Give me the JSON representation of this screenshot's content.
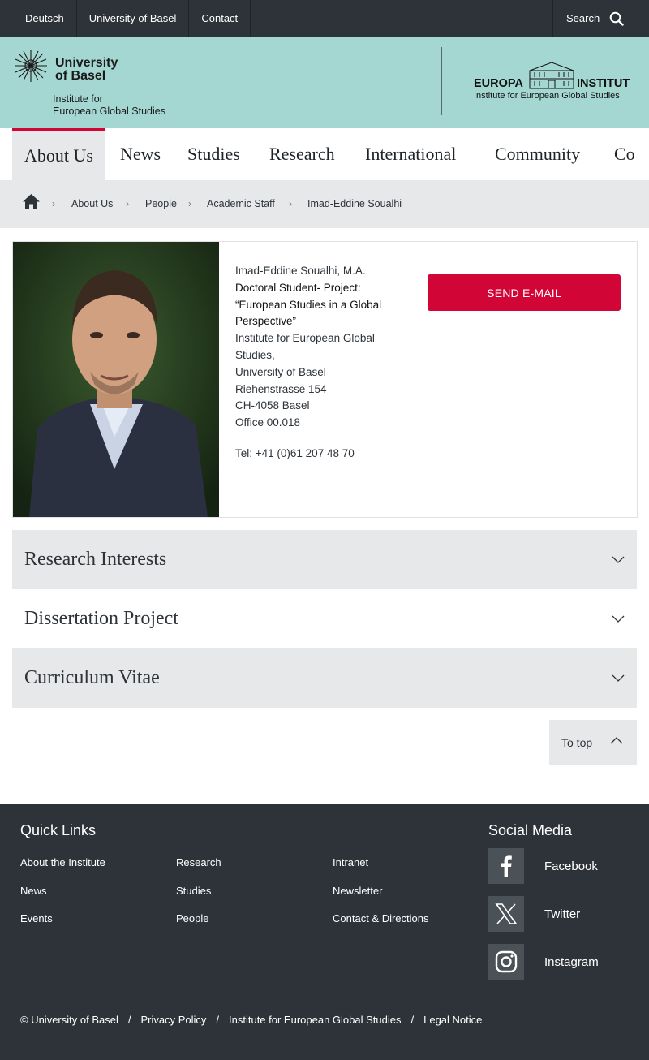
{
  "topbar": {
    "links": [
      "Deutsch",
      "University of Basel",
      "Contact"
    ],
    "search_label": "Search"
  },
  "header": {
    "university_line1": "University",
    "university_line2": "of Basel",
    "institute_line1": "Institute for",
    "institute_line2": "European Global Studies",
    "europa_left": "EUROPA",
    "europa_right": "INSTITUT",
    "europa_sub": "Institute for European Global Studies"
  },
  "nav": {
    "items": [
      "About Us",
      "News",
      "Studies",
      "Research",
      "International",
      "Community",
      "Co"
    ],
    "active": "About Us"
  },
  "breadcrumb": {
    "items": [
      "About Us",
      "People",
      "Academic Staff",
      "Imad-Eddine Soualhi"
    ]
  },
  "profile": {
    "name": "Imad-Eddine Soualhi, M.A.",
    "role_line1": "Doctoral Student- Project:",
    "role_line2": "“European Studies in a Global",
    "role_line3": "Perspective”",
    "inst_line1": "Institute for European Global",
    "inst_line2": "Studies,",
    "university": "University of Basel",
    "street": "Riehenstrasse 154",
    "city": "CH-4058 Basel",
    "office": "Office 00.018",
    "tel": "Tel: +41 (0)61 207 48 70",
    "email_button": "SEND E-MAIL"
  },
  "accordions": [
    "Research Interests",
    "Dissertation Project",
    "Curriculum Vitae"
  ],
  "to_top": "To top",
  "footer": {
    "quick_links_title": "Quick Links",
    "col1": [
      "About the Institute",
      "News",
      "Events"
    ],
    "col2": [
      "Research",
      "Studies",
      "People"
    ],
    "col3": [
      "Intranet",
      "Newsletter",
      "Contact & Directions"
    ],
    "social_title": "Social Media",
    "social": [
      "Facebook",
      "Twitter",
      "Instagram"
    ],
    "legal": [
      "© University of Basel",
      "Privacy Policy",
      "Institute for European Global Studies",
      "Legal Notice"
    ]
  },
  "colors": {
    "dark": "#2d3339",
    "mint": "#a5d7d2",
    "accent_red": "#d20537",
    "light_grey": "#e7e8ea"
  }
}
